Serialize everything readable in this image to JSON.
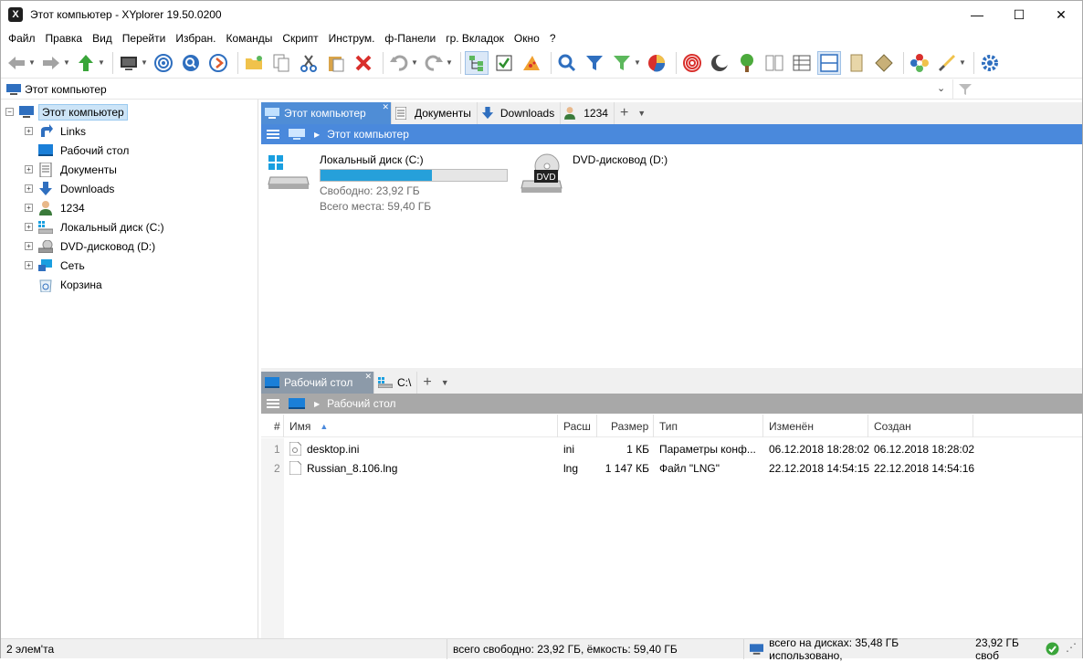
{
  "window": {
    "title": "Этот компьютер - XYplorer 19.50.0200",
    "app_icon_letter": "X"
  },
  "window_controls": {
    "minimize": "—",
    "maximize": "☐",
    "close": "✕"
  },
  "menu": [
    "Файл",
    "Правка",
    "Вид",
    "Перейти",
    "Избран.",
    "Команды",
    "Скрипт",
    "Инструм.",
    "ф-Панели",
    "гр. Вкладок",
    "Окно",
    "?"
  ],
  "address": {
    "path": "Этот компьютер"
  },
  "tree": [
    {
      "label": "Этот компьютер",
      "icon": "computer-icon",
      "expander": "−",
      "selected": true
    },
    {
      "label": "Links",
      "icon": "link-icon",
      "expander": "+"
    },
    {
      "label": "Рабочий стол",
      "icon": "desktop-icon",
      "expander": ""
    },
    {
      "label": "Документы",
      "icon": "documents-icon",
      "expander": "+"
    },
    {
      "label": "Downloads",
      "icon": "download-icon",
      "expander": "+"
    },
    {
      "label": "1234",
      "icon": "user-icon",
      "expander": "+"
    },
    {
      "label": "Локальный диск (C:)",
      "icon": "drive-icon",
      "expander": "+"
    },
    {
      "label": "DVD-дисковод (D:)",
      "icon": "dvd-icon",
      "expander": "+"
    },
    {
      "label": "Сеть",
      "icon": "network-icon",
      "expander": "+"
    },
    {
      "label": "Корзина",
      "icon": "recycle-bin-icon",
      "expander": ""
    }
  ],
  "top_pane": {
    "tabs": [
      {
        "label": "Этот компьютер",
        "icon": "computer-icon",
        "active": true
      },
      {
        "label": "Документы",
        "icon": "documents-icon"
      },
      {
        "label": "Downloads",
        "icon": "download-icon"
      },
      {
        "label": "1234",
        "icon": "user-icon"
      }
    ],
    "tab_close": "✕",
    "tab_plus": "+",
    "tab_menu": "▼",
    "breadcrumb": "Этот компьютер",
    "drives": [
      {
        "name": "Локальный диск (C:)",
        "free": "Свободно: 23,92 ГБ",
        "total": "Всего места: 59,40 ГБ",
        "used_fraction": 0.597
      },
      {
        "name": "DVD-дисковод (D:)",
        "badge": "DVD"
      }
    ]
  },
  "bottom_pane": {
    "tabs": [
      {
        "label": "Рабочий стол",
        "icon": "desktop-icon",
        "active": true
      },
      {
        "label": "C:\\",
        "icon": "drive-icon"
      }
    ],
    "breadcrumb": "Рабочий стол",
    "columns": [
      "#",
      "Имя",
      "Расш",
      "Размер",
      "Тип",
      "Изменён",
      "Создан"
    ],
    "sort_indicator": "▲",
    "rows": [
      {
        "num": "1",
        "name": "desktop.ini",
        "ext": "ini",
        "size": "1 КБ",
        "type": "Параметры конф...",
        "modified": "06.12.2018 18:28:02",
        "created": "06.12.2018 18:28:02"
      },
      {
        "num": "2",
        "name": "Russian_8.106.lng",
        "ext": "lng",
        "size": "1 147 КБ",
        "type": "Файл \"LNG\"",
        "modified": "22.12.2018 14:54:15",
        "created": "22.12.2018 14:54:16"
      }
    ]
  },
  "status": {
    "items": "2 элем'та",
    "free": "всего свободно: 23,92 ГБ, ёмкость: 59,40 ГБ",
    "disks": "всего на дисках: 35,48 ГБ использовано,",
    "disks_free": "23,92 ГБ своб"
  },
  "colors": {
    "accent": "#4a89dc",
    "progress": "#26a0da",
    "selection": "#cce4f7"
  }
}
